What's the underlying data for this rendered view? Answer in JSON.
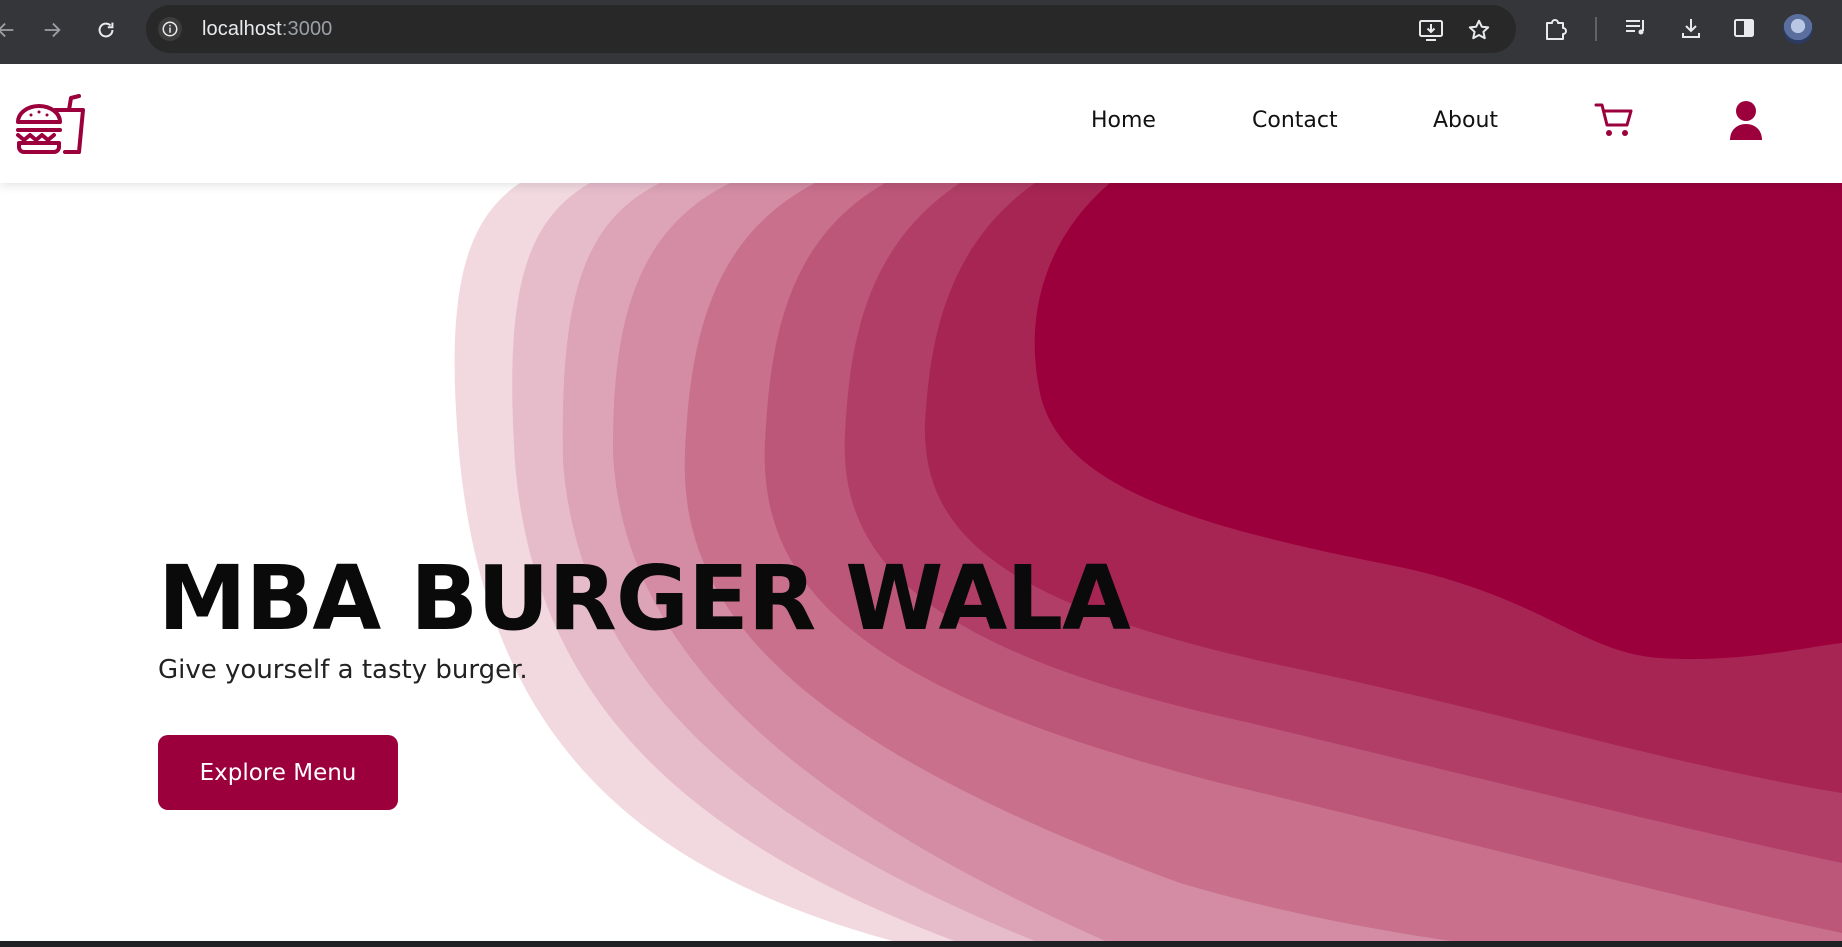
{
  "browser": {
    "url_host": "localhost",
    "url_port": ":3000",
    "icons": [
      "back-icon",
      "forward-icon",
      "reload-icon",
      "site-info-icon",
      "install-app-icon",
      "bookmark-star-icon",
      "extensions-icon",
      "media-control-icon",
      "downloads-icon",
      "side-panel-icon",
      "profile-avatar"
    ]
  },
  "site": {
    "brand_color": "#9c003c",
    "nav": {
      "home": "Home",
      "contact": "Contact",
      "about": "About"
    },
    "hero": {
      "title": "MBA BURGER WALA",
      "subtitle": "Give yourself a tasty burger.",
      "cta": "Explore Menu"
    }
  }
}
